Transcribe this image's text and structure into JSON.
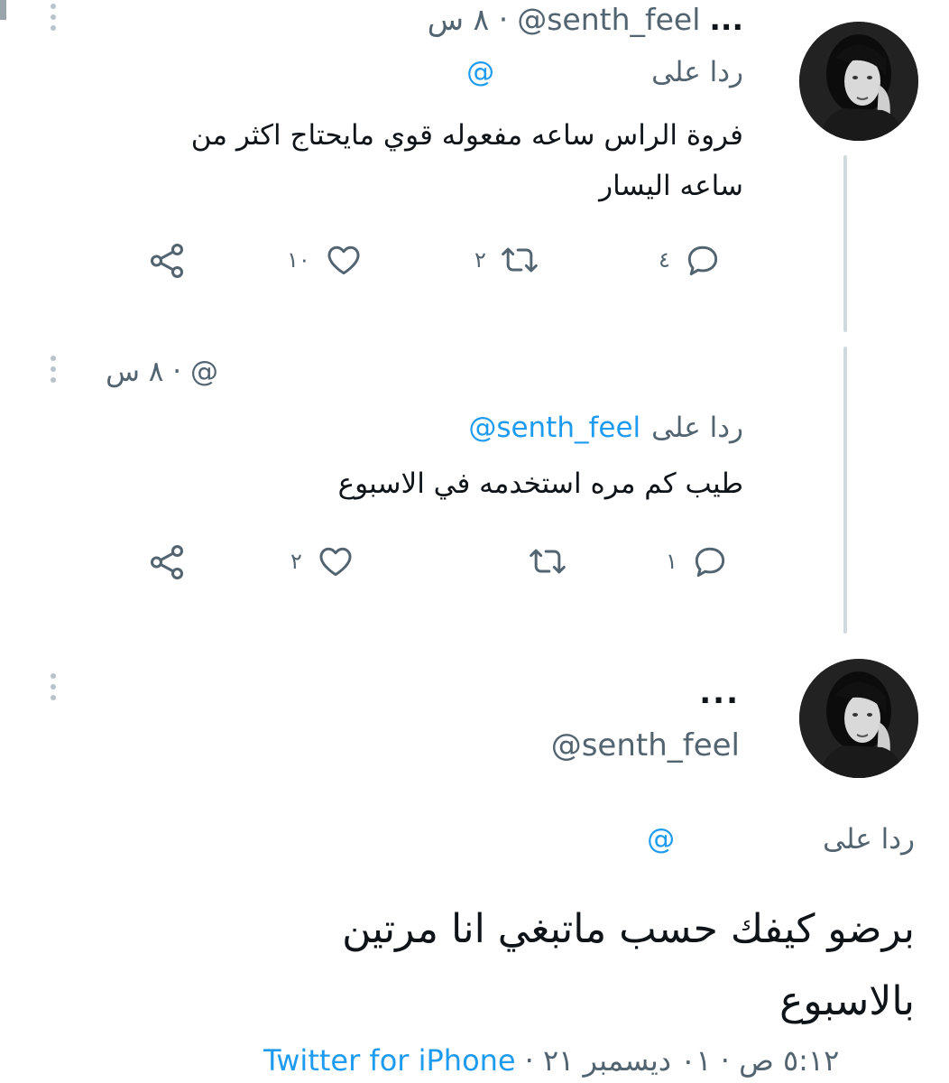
{
  "tweet1": {
    "header_more": "...",
    "handle": "@senth_feel",
    "time": "· ٨ س",
    "reply_label": "ردا على",
    "reply_handle": "@",
    "text_line1": "فروة الراس ساعه مفعوله قوي مايحتاج اكثر من",
    "text_line2": "ساعه اليسار",
    "actions": {
      "reply_count": "٤",
      "retweet_count": "٢",
      "like_count": "١٠"
    }
  },
  "tweet2": {
    "header": "@ · ٨ س",
    "reply_label": "ردا على",
    "reply_handle": "@senth_feel",
    "text": "طيب كم مره استخدمه في الاسبوع",
    "actions": {
      "reply_count": "١",
      "retweet_count": "",
      "like_count": "٢"
    }
  },
  "main_tweet": {
    "more": "...",
    "handle": "@senth_feel",
    "reply_label": "ردا على",
    "reply_handle": "@",
    "text_line1": "برضو كيفك حسب ماتبغي انا مرتين",
    "text_line2": "بالاسبوع",
    "timestamp": "٥:١٢ ص · ٠١ ديسمبر ٢١ ·",
    "source": "Twitter for iPhone"
  },
  "icons": [
    "share-icon",
    "like-icon",
    "retweet-icon",
    "reply-icon",
    "more-dots-icon",
    "avatar"
  ],
  "colors": {
    "accent": "#1d9bf0",
    "muted": "#536471",
    "text": "#0f1419",
    "line": "#cfd9de"
  }
}
